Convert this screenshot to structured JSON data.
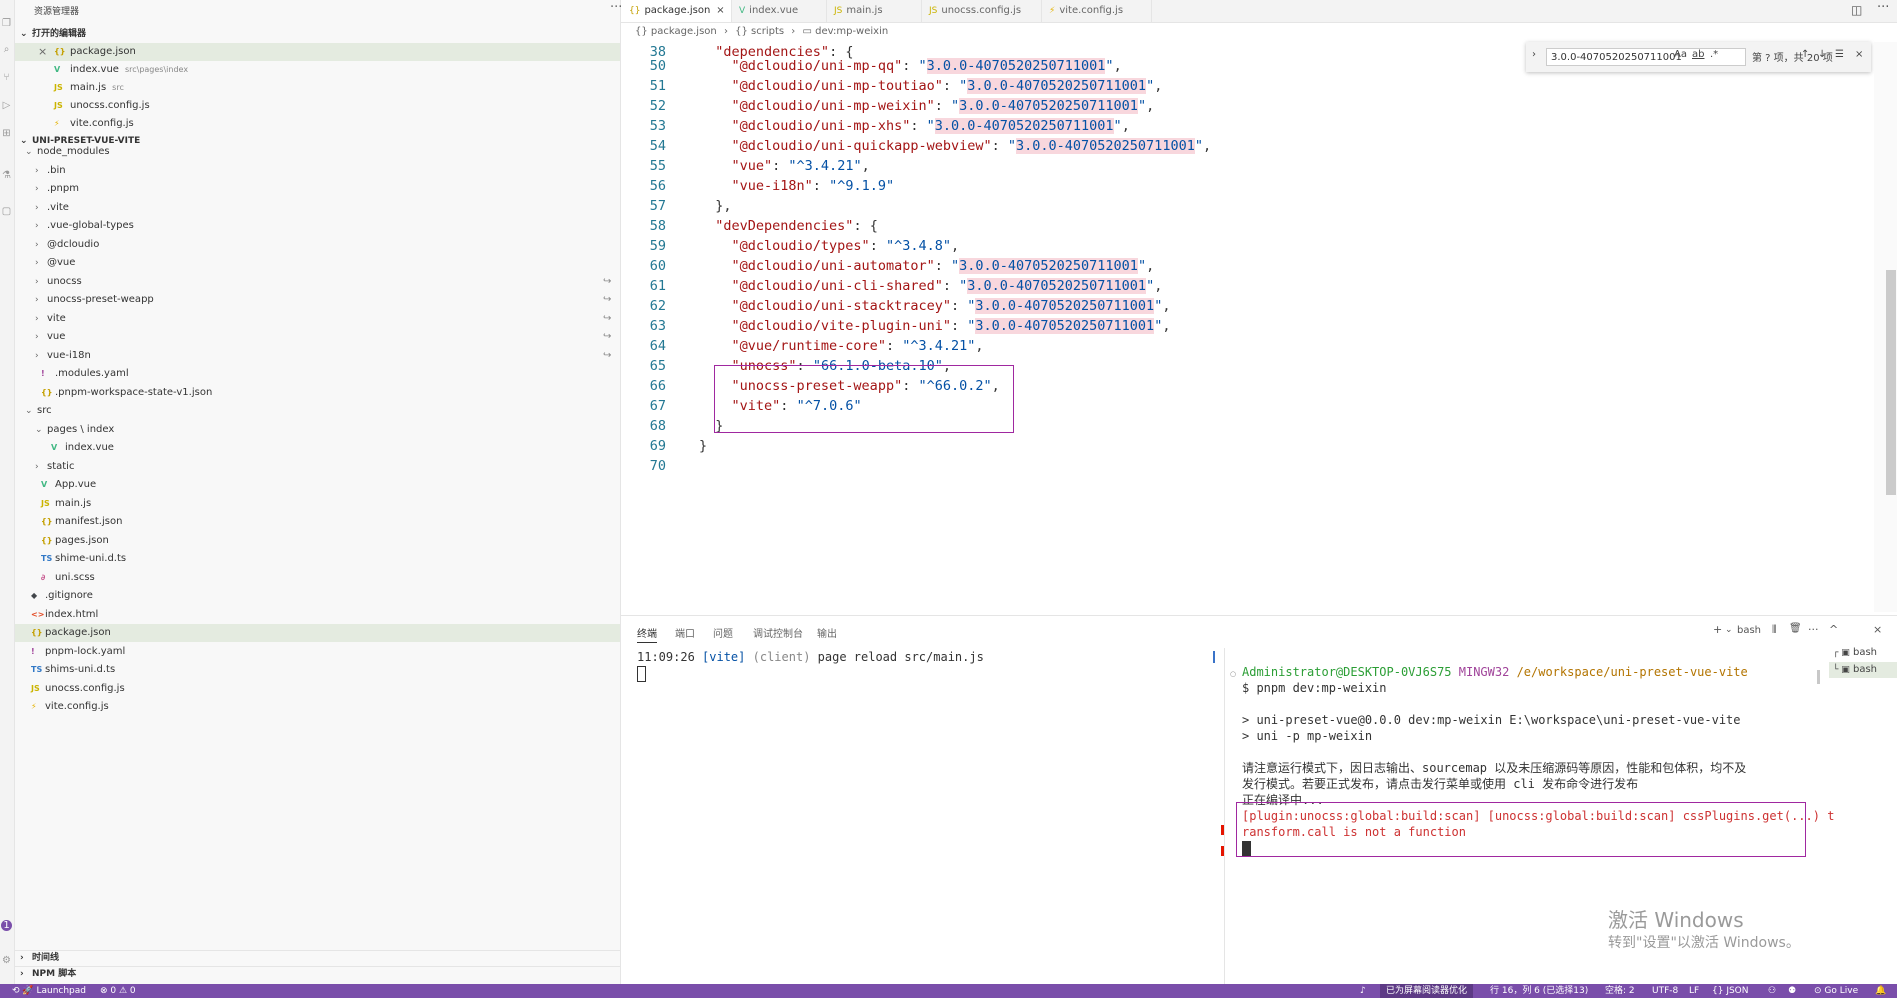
{
  "explorer": {
    "title": "资源管理器",
    "more": "···",
    "open_editors_heading": "打开的编辑器",
    "open_editors": [
      {
        "icon": "{}",
        "name": "package.json",
        "hint": "",
        "type": "json"
      },
      {
        "icon": "V",
        "name": "index.vue",
        "hint": "src\\pages\\index",
        "type": "vue"
      },
      {
        "icon": "JS",
        "name": "main.js",
        "hint": "src",
        "type": "js"
      },
      {
        "icon": "JS",
        "name": "unocss.config.js",
        "hint": "",
        "type": "js"
      },
      {
        "icon": "⚡",
        "name": "vite.config.js",
        "hint": "",
        "type": "vite"
      }
    ],
    "project_heading": "UNI-PRESET-VUE-VITE",
    "tree": [
      {
        "label": "node_modules",
        "indent": 0,
        "twisty": "⌄",
        "icon": "",
        "type": ""
      },
      {
        "label": ".bin",
        "indent": 1,
        "twisty": "›",
        "icon": "",
        "type": ""
      },
      {
        "label": ".pnpm",
        "indent": 1,
        "twisty": "›",
        "icon": "",
        "type": ""
      },
      {
        "label": ".vite",
        "indent": 1,
        "twisty": "›",
        "icon": "",
        "type": ""
      },
      {
        "label": ".vue-global-types",
        "indent": 1,
        "twisty": "›",
        "icon": "",
        "type": ""
      },
      {
        "label": "@dcloudio",
        "indent": 1,
        "twisty": "›",
        "icon": "",
        "type": ""
      },
      {
        "label": "@vue",
        "indent": 1,
        "twisty": "›",
        "icon": "",
        "type": ""
      },
      {
        "label": "unocss",
        "indent": 1,
        "twisty": "›",
        "icon": "",
        "type": "",
        "dot": "↪"
      },
      {
        "label": "unocss-preset-weapp",
        "indent": 1,
        "twisty": "›",
        "icon": "",
        "type": "",
        "dot": "↪"
      },
      {
        "label": "vite",
        "indent": 1,
        "twisty": "›",
        "icon": "",
        "type": "",
        "dot": "↪"
      },
      {
        "label": "vue",
        "indent": 1,
        "twisty": "›",
        "icon": "",
        "type": "",
        "dot": "↪"
      },
      {
        "label": "vue-i18n",
        "indent": 1,
        "twisty": "›",
        "icon": "",
        "type": "",
        "dot": "↪"
      },
      {
        "label": ".modules.yaml",
        "indent": 1,
        "twisty": "",
        "icon": "!",
        "type": "yaml"
      },
      {
        "label": ".pnpm-workspace-state-v1.json",
        "indent": 1,
        "twisty": "",
        "icon": "{}",
        "type": "json"
      },
      {
        "label": "src",
        "indent": 0,
        "twisty": "⌄",
        "icon": "",
        "type": ""
      },
      {
        "label": "pages \\ index",
        "indent": 1,
        "twisty": "⌄",
        "icon": "",
        "type": ""
      },
      {
        "label": "index.vue",
        "indent": 2,
        "twisty": "",
        "icon": "V",
        "type": "vue"
      },
      {
        "label": "static",
        "indent": 1,
        "twisty": "›",
        "icon": "",
        "type": ""
      },
      {
        "label": "App.vue",
        "indent": 1,
        "twisty": "",
        "icon": "V",
        "type": "vue"
      },
      {
        "label": "main.js",
        "indent": 1,
        "twisty": "",
        "icon": "JS",
        "type": "js"
      },
      {
        "label": "manifest.json",
        "indent": 1,
        "twisty": "",
        "icon": "{}",
        "type": "json"
      },
      {
        "label": "pages.json",
        "indent": 1,
        "twisty": "",
        "icon": "{}",
        "type": "json"
      },
      {
        "label": "shime-uni.d.ts",
        "indent": 1,
        "twisty": "",
        "icon": "TS",
        "type": "ts"
      },
      {
        "label": "uni.scss",
        "indent": 1,
        "twisty": "",
        "icon": "∂",
        "type": "scss"
      },
      {
        "label": ".gitignore",
        "indent": 0,
        "twisty": "",
        "icon": "◆",
        "type": "git"
      },
      {
        "label": "index.html",
        "indent": 0,
        "twisty": "",
        "icon": "<>",
        "type": "html"
      },
      {
        "label": "package.json",
        "indent": 0,
        "twisty": "",
        "icon": "{}",
        "type": "json",
        "selected": true
      },
      {
        "label": "pnpm-lock.yaml",
        "indent": 0,
        "twisty": "",
        "icon": "!",
        "type": "yaml"
      },
      {
        "label": "shims-uni.d.ts",
        "indent": 0,
        "twisty": "",
        "icon": "TS",
        "type": "ts"
      },
      {
        "label": "unocss.config.js",
        "indent": 0,
        "twisty": "",
        "icon": "JS",
        "type": "js"
      },
      {
        "label": "vite.config.js",
        "indent": 0,
        "twisty": "",
        "icon": "⚡",
        "type": "vite"
      }
    ],
    "timeline_heading": "时间线",
    "npm_heading": "NPM 脚本"
  },
  "tabs": [
    {
      "icon": "{}",
      "label": "package.json",
      "active": true,
      "close": "×",
      "type": "json"
    },
    {
      "icon": "V",
      "label": "index.vue",
      "active": false,
      "close": "",
      "type": "vue"
    },
    {
      "icon": "JS",
      "label": "main.js",
      "active": false,
      "close": "",
      "type": "js"
    },
    {
      "icon": "JS",
      "label": "unocss.config.js",
      "active": false,
      "close": "",
      "type": "js"
    },
    {
      "icon": "⚡",
      "label": "vite.config.js",
      "active": false,
      "close": "",
      "type": "vite"
    }
  ],
  "breadcrumb": {
    "file": "{} package.json",
    "sep": "›",
    "scripts": "{} scripts",
    "script": "▭ dev:mp-weixin"
  },
  "editor": {
    "lines": [
      {
        "n": "38",
        "parts": [
          [
            "p",
            "  "
          ],
          [
            "k",
            "\"dependencies\""
          ],
          [
            "p",
            ": {"
          ]
        ]
      },
      {
        "n": "50",
        "parts": [
          [
            "p",
            "    "
          ],
          [
            "k",
            "\"@dcloudio/uni-mp-qq\""
          ],
          [
            "p",
            ": "
          ],
          [
            "v",
            "\""
          ],
          [
            "vh",
            "3.0.0-4070520250711001"
          ],
          [
            "v",
            "\""
          ],
          [
            "p",
            ","
          ]
        ]
      },
      {
        "n": "51",
        "parts": [
          [
            "p",
            "    "
          ],
          [
            "k",
            "\"@dcloudio/uni-mp-toutiao\""
          ],
          [
            "p",
            ": "
          ],
          [
            "v",
            "\""
          ],
          [
            "vh",
            "3.0.0-4070520250711001"
          ],
          [
            "v",
            "\""
          ],
          [
            "p",
            ","
          ]
        ]
      },
      {
        "n": "52",
        "parts": [
          [
            "p",
            "    "
          ],
          [
            "k",
            "\"@dcloudio/uni-mp-weixin\""
          ],
          [
            "p",
            ": "
          ],
          [
            "v",
            "\""
          ],
          [
            "vh",
            "3.0.0-4070520250711001"
          ],
          [
            "v",
            "\""
          ],
          [
            "p",
            ","
          ]
        ]
      },
      {
        "n": "53",
        "parts": [
          [
            "p",
            "    "
          ],
          [
            "k",
            "\"@dcloudio/uni-mp-xhs\""
          ],
          [
            "p",
            ": "
          ],
          [
            "v",
            "\""
          ],
          [
            "vh",
            "3.0.0-4070520250711001"
          ],
          [
            "v",
            "\""
          ],
          [
            "p",
            ","
          ]
        ]
      },
      {
        "n": "54",
        "parts": [
          [
            "p",
            "    "
          ],
          [
            "k",
            "\"@dcloudio/uni-quickapp-webview\""
          ],
          [
            "p",
            ": "
          ],
          [
            "v",
            "\""
          ],
          [
            "vh",
            "3.0.0-4070520250711001"
          ],
          [
            "v",
            "\""
          ],
          [
            "p",
            ","
          ]
        ]
      },
      {
        "n": "55",
        "parts": [
          [
            "p",
            "    "
          ],
          [
            "k",
            "\"vue\""
          ],
          [
            "p",
            ": "
          ],
          [
            "v",
            "\"^3.4.21\""
          ],
          [
            "p",
            ","
          ]
        ]
      },
      {
        "n": "56",
        "parts": [
          [
            "p",
            "    "
          ],
          [
            "k",
            "\"vue-i18n\""
          ],
          [
            "p",
            ": "
          ],
          [
            "v",
            "\"^9.1.9\""
          ]
        ]
      },
      {
        "n": "57",
        "parts": [
          [
            "p",
            "  },"
          ]
        ]
      },
      {
        "n": "58",
        "parts": [
          [
            "p",
            "  "
          ],
          [
            "k",
            "\"devDependencies\""
          ],
          [
            "p",
            ": {"
          ]
        ]
      },
      {
        "n": "59",
        "parts": [
          [
            "p",
            "    "
          ],
          [
            "k",
            "\"@dcloudio/types\""
          ],
          [
            "p",
            ": "
          ],
          [
            "v",
            "\"^3.4.8\""
          ],
          [
            "p",
            ","
          ]
        ]
      },
      {
        "n": "60",
        "parts": [
          [
            "p",
            "    "
          ],
          [
            "k",
            "\"@dcloudio/uni-automator\""
          ],
          [
            "p",
            ": "
          ],
          [
            "v",
            "\""
          ],
          [
            "vh",
            "3.0.0-4070520250711001"
          ],
          [
            "v",
            "\""
          ],
          [
            "p",
            ","
          ]
        ]
      },
      {
        "n": "61",
        "parts": [
          [
            "p",
            "    "
          ],
          [
            "k",
            "\"@dcloudio/uni-cli-shared\""
          ],
          [
            "p",
            ": "
          ],
          [
            "v",
            "\""
          ],
          [
            "vh",
            "3.0.0-4070520250711001"
          ],
          [
            "v",
            "\""
          ],
          [
            "p",
            ","
          ]
        ]
      },
      {
        "n": "62",
        "parts": [
          [
            "p",
            "    "
          ],
          [
            "k",
            "\"@dcloudio/uni-stacktracey\""
          ],
          [
            "p",
            ": "
          ],
          [
            "v",
            "\""
          ],
          [
            "vh",
            "3.0.0-4070520250711001"
          ],
          [
            "v",
            "\""
          ],
          [
            "p",
            ","
          ]
        ]
      },
      {
        "n": "63",
        "parts": [
          [
            "p",
            "    "
          ],
          [
            "k",
            "\"@dcloudio/vite-plugin-uni\""
          ],
          [
            "p",
            ": "
          ],
          [
            "v",
            "\""
          ],
          [
            "vh",
            "3.0.0-4070520250711001"
          ],
          [
            "v",
            "\""
          ],
          [
            "p",
            ","
          ]
        ]
      },
      {
        "n": "64",
        "parts": [
          [
            "p",
            "    "
          ],
          [
            "k",
            "\"@vue/runtime-core\""
          ],
          [
            "p",
            ": "
          ],
          [
            "v",
            "\"^3.4.21\""
          ],
          [
            "p",
            ","
          ]
        ]
      },
      {
        "n": "65",
        "parts": [
          [
            "p",
            "    "
          ],
          [
            "k",
            "\"unocss\""
          ],
          [
            "p",
            ": "
          ],
          [
            "v",
            "\"66.1.0-beta.10\""
          ],
          [
            "p",
            ","
          ]
        ]
      },
      {
        "n": "66",
        "parts": [
          [
            "p",
            "    "
          ],
          [
            "k",
            "\"unocss-preset-weapp\""
          ],
          [
            "p",
            ": "
          ],
          [
            "v",
            "\"^66.0.2\""
          ],
          [
            "p",
            ","
          ]
        ]
      },
      {
        "n": "67",
        "parts": [
          [
            "p",
            "    "
          ],
          [
            "k",
            "\"vite\""
          ],
          [
            "p",
            ": "
          ],
          [
            "v",
            "\"^7.0.6\""
          ]
        ]
      },
      {
        "n": "68",
        "parts": [
          [
            "p",
            "  }"
          ]
        ]
      },
      {
        "n": "69",
        "parts": [
          [
            "p",
            "}"
          ]
        ]
      },
      {
        "n": "70",
        "parts": []
      }
    ]
  },
  "find": {
    "query": "3.0.0-4070520250711001",
    "opt_case": "Aa",
    "opt_word": "ab",
    "opt_regex": ".*",
    "result": "第 ? 项，共 20 项",
    "prev": "↑",
    "next": "↓",
    "selection": "☰",
    "close": "×",
    "toggle": "›"
  },
  "panel": {
    "tabs": [
      "终端",
      "端口",
      "问题",
      "调试控制台",
      "输出"
    ],
    "tools": {
      "add": "+",
      "dropdown": "⌄",
      "shell": "bash",
      "split": "⫴",
      "trash": "🗑",
      "more": "···",
      "max": "^",
      "close": "×"
    },
    "terminal_left": {
      "time": "11:09:26",
      "tag": "[vite]",
      "scope": "(client)",
      "msg": "page reload src/main.js"
    },
    "terminal_right": {
      "prompt_user": "Administrator@DESKTOP-0VJ6S75",
      "prompt_env": "MINGW32",
      "prompt_path": "/e/workspace/uni-preset-vue-vite",
      "cmd": "$ pnpm dev:mp-weixin",
      "out1": "> uni-preset-vue@0.0.0 dev:mp-weixin E:\\workspace\\uni-preset-vue-vite",
      "out2": "> uni -p mp-weixin",
      "notice1": "请注意运行模式下，因日志输出、sourcemap 以及未压缩源码等原因，性能和包体积，均不及",
      "notice2": "发行模式。若要正式发布，请点击发行菜单或使用 cli 发布命令进行发布",
      "compiling": "正在编译中...",
      "error1": "[plugin:unocss:global:build:scan] [unocss:global:build:scan] cssPlugins.get(...) t",
      "error2": "ransform.call is not a function"
    },
    "terminal_list": [
      "bash",
      "bash"
    ]
  },
  "watermark": {
    "line1": "激活 Windows",
    "line2": "转到\"设置\"以激活 Windows。"
  },
  "status": {
    "remote": "⟲ 🚀 Launchpad",
    "problems": "⊗ 0 ⚠ 0",
    "bell_left": "♪",
    "screen_reader": "已为屏幕阅读器优化",
    "position": "行 16，列 6 (已选择13)",
    "spaces": "空格: 2",
    "encoding": "UTF-8",
    "eol": "LF",
    "lang": "{} JSON",
    "golive": "⊙ Go Live",
    "bell": "🔔"
  }
}
